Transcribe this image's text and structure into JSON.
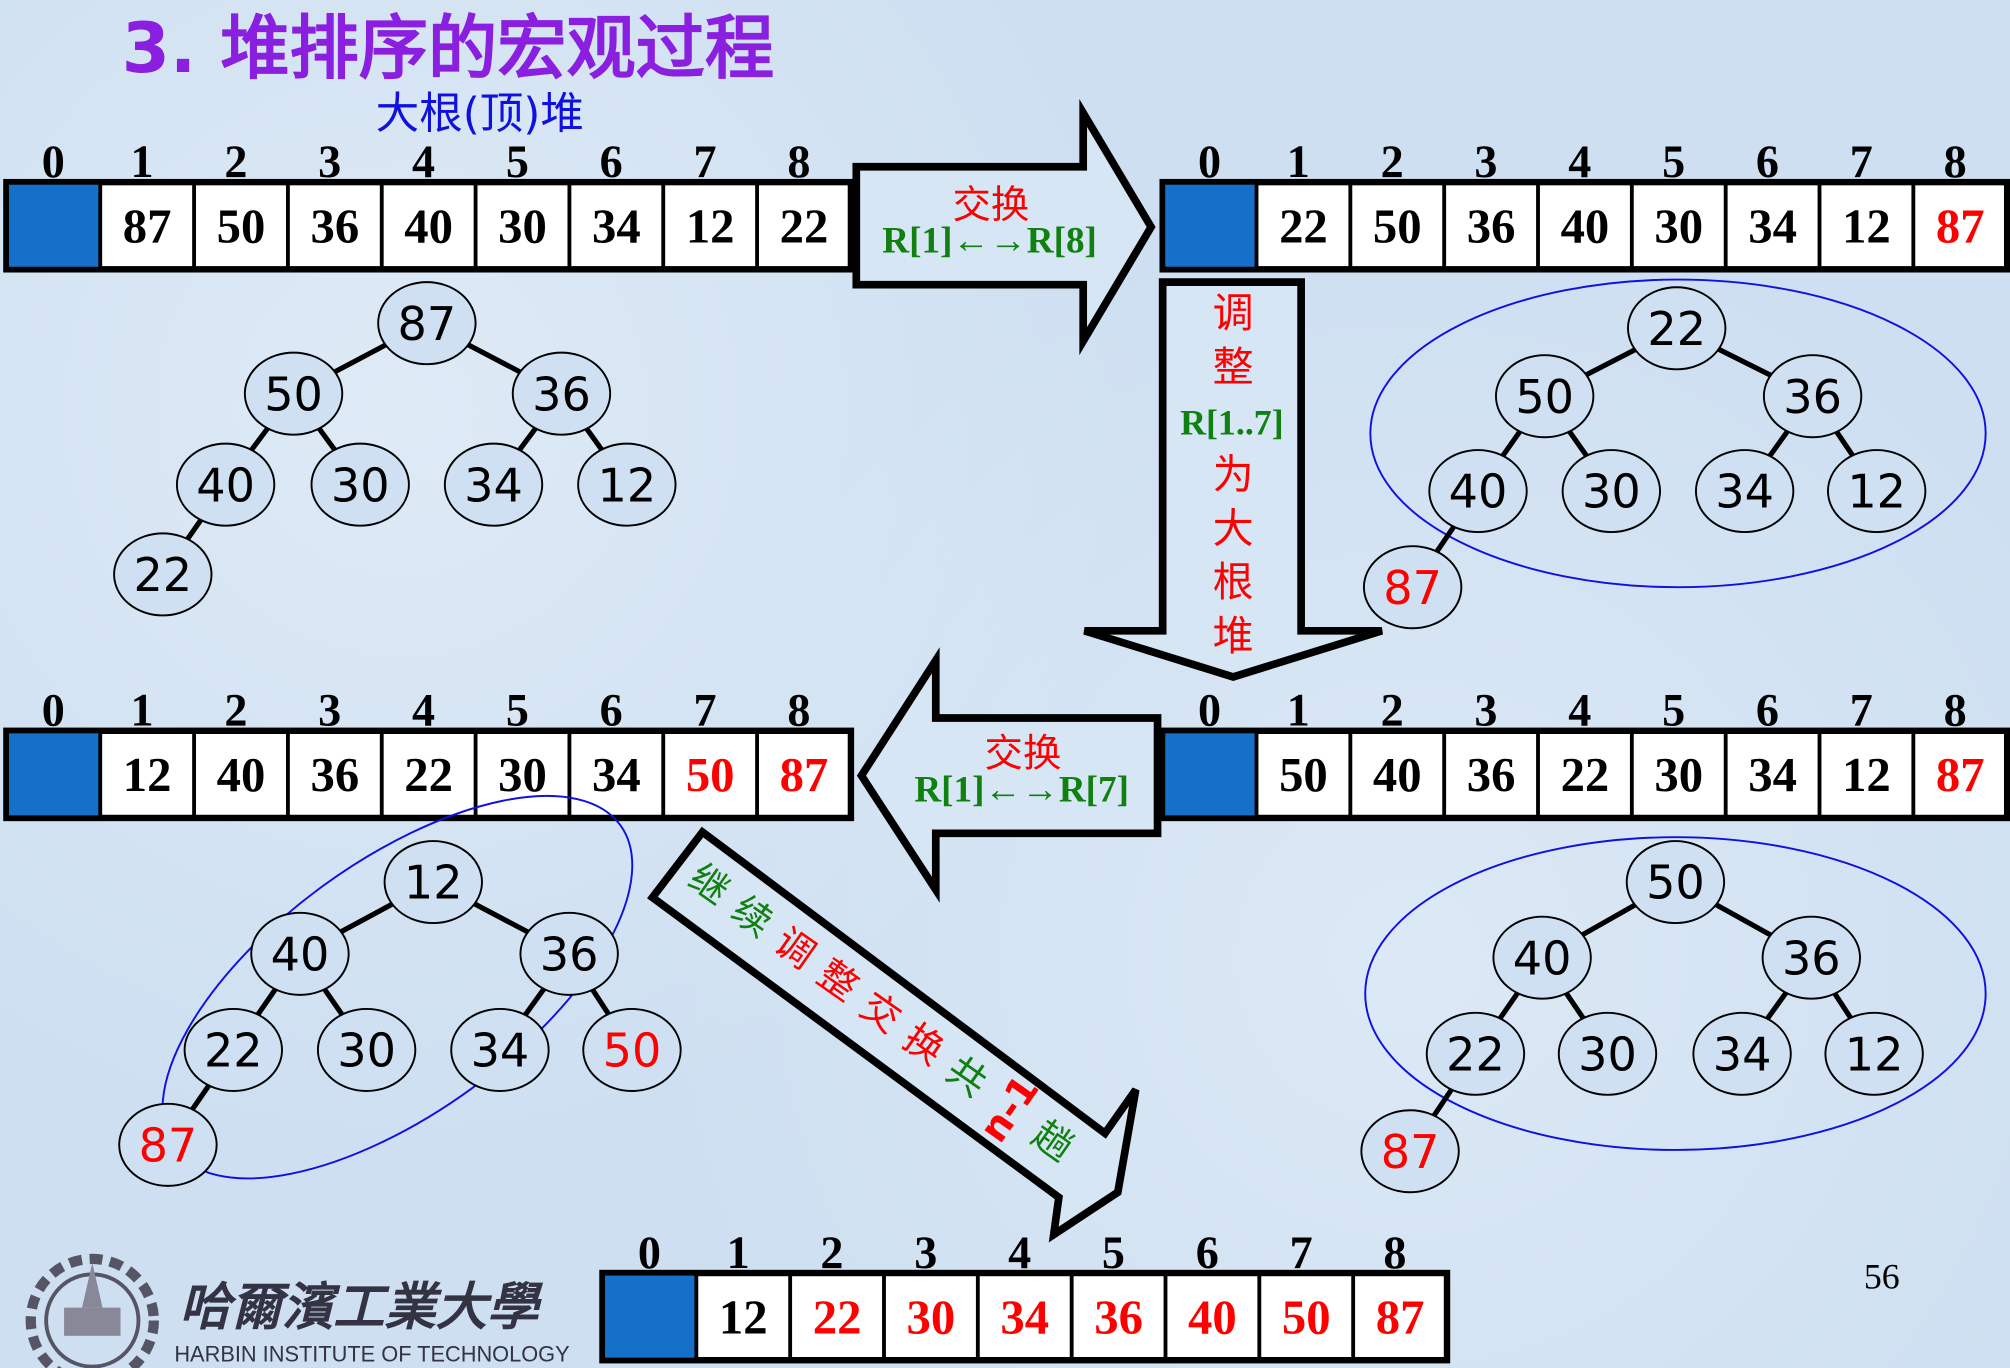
{
  "title": "3. 堆排序的宏观过程",
  "subtitle": "大根(顶)堆",
  "page_number": "56",
  "logo": {
    "cn": "哈爾濱工業大學",
    "en": "HARBIN INSTITUTE OF TECHNOLOGY"
  },
  "colors": {
    "title": "#8a1fe0",
    "subtitle": "#1010e0",
    "red": "#ff0000",
    "green": "#108010",
    "cell0": "#1470c8",
    "ellipse": "#1010e0"
  },
  "index_labels": [
    "0",
    "1",
    "2",
    "3",
    "4",
    "5",
    "6",
    "7",
    "8"
  ],
  "arrays": [
    {
      "id": "array-initial",
      "values": [
        "87",
        "50",
        "36",
        "40",
        "30",
        "34",
        "12",
        "22"
      ],
      "red": []
    },
    {
      "id": "array-after-swap-1-8",
      "values": [
        "22",
        "50",
        "36",
        "40",
        "30",
        "34",
        "12",
        "87"
      ],
      "red": [
        8
      ]
    },
    {
      "id": "array-after-swap-1-7",
      "values": [
        "12",
        "40",
        "36",
        "22",
        "30",
        "34",
        "50",
        "87"
      ],
      "red": [
        7,
        8
      ]
    },
    {
      "id": "array-after-adjust",
      "values": [
        "50",
        "40",
        "36",
        "22",
        "30",
        "34",
        "12",
        "87"
      ],
      "red": [
        8
      ]
    },
    {
      "id": "array-final",
      "values": [
        "12",
        "22",
        "30",
        "34",
        "36",
        "40",
        "50",
        "87"
      ],
      "red": [
        2,
        3,
        4,
        5,
        6,
        7,
        8
      ]
    }
  ],
  "trees": [
    {
      "id": "tree-initial",
      "nodes": [
        "87",
        "50",
        "36",
        "40",
        "30",
        "34",
        "12",
        "22"
      ],
      "red": []
    },
    {
      "id": "tree-after-swap-1-8",
      "nodes": [
        "22",
        "50",
        "36",
        "40",
        "30",
        "34",
        "12",
        "87"
      ],
      "red": [
        8
      ]
    },
    {
      "id": "tree-after-swap-1-7",
      "nodes": [
        "12",
        "40",
        "36",
        "22",
        "30",
        "34",
        "50",
        "87"
      ],
      "red": [
        7,
        8
      ]
    },
    {
      "id": "tree-after-adjust",
      "nodes": [
        "50",
        "40",
        "36",
        "22",
        "30",
        "34",
        "12",
        "87"
      ],
      "red": [
        8
      ]
    }
  ],
  "arrows": {
    "swap1": {
      "label": "交换",
      "detail": "R[1]←→R[8]"
    },
    "adjust": {
      "chars_top": [
        "调",
        "整"
      ],
      "range": "R[1..7]",
      "chars_bottom": [
        "为",
        "大",
        "根",
        "堆"
      ]
    },
    "swap2": {
      "label": "交换",
      "detail": "R[1]←→R[7]"
    },
    "continue": [
      {
        "t": "继",
        "c": "green"
      },
      {
        "t": "续",
        "c": "green"
      },
      {
        "t": "调",
        "c": "red"
      },
      {
        "t": "整",
        "c": "red"
      },
      {
        "t": "交",
        "c": "red"
      },
      {
        "t": "换",
        "c": "red"
      },
      {
        "t": "共",
        "c": "green"
      },
      {
        "t": "n-1",
        "c": "red"
      },
      {
        "t": "趟",
        "c": "green"
      }
    ]
  }
}
